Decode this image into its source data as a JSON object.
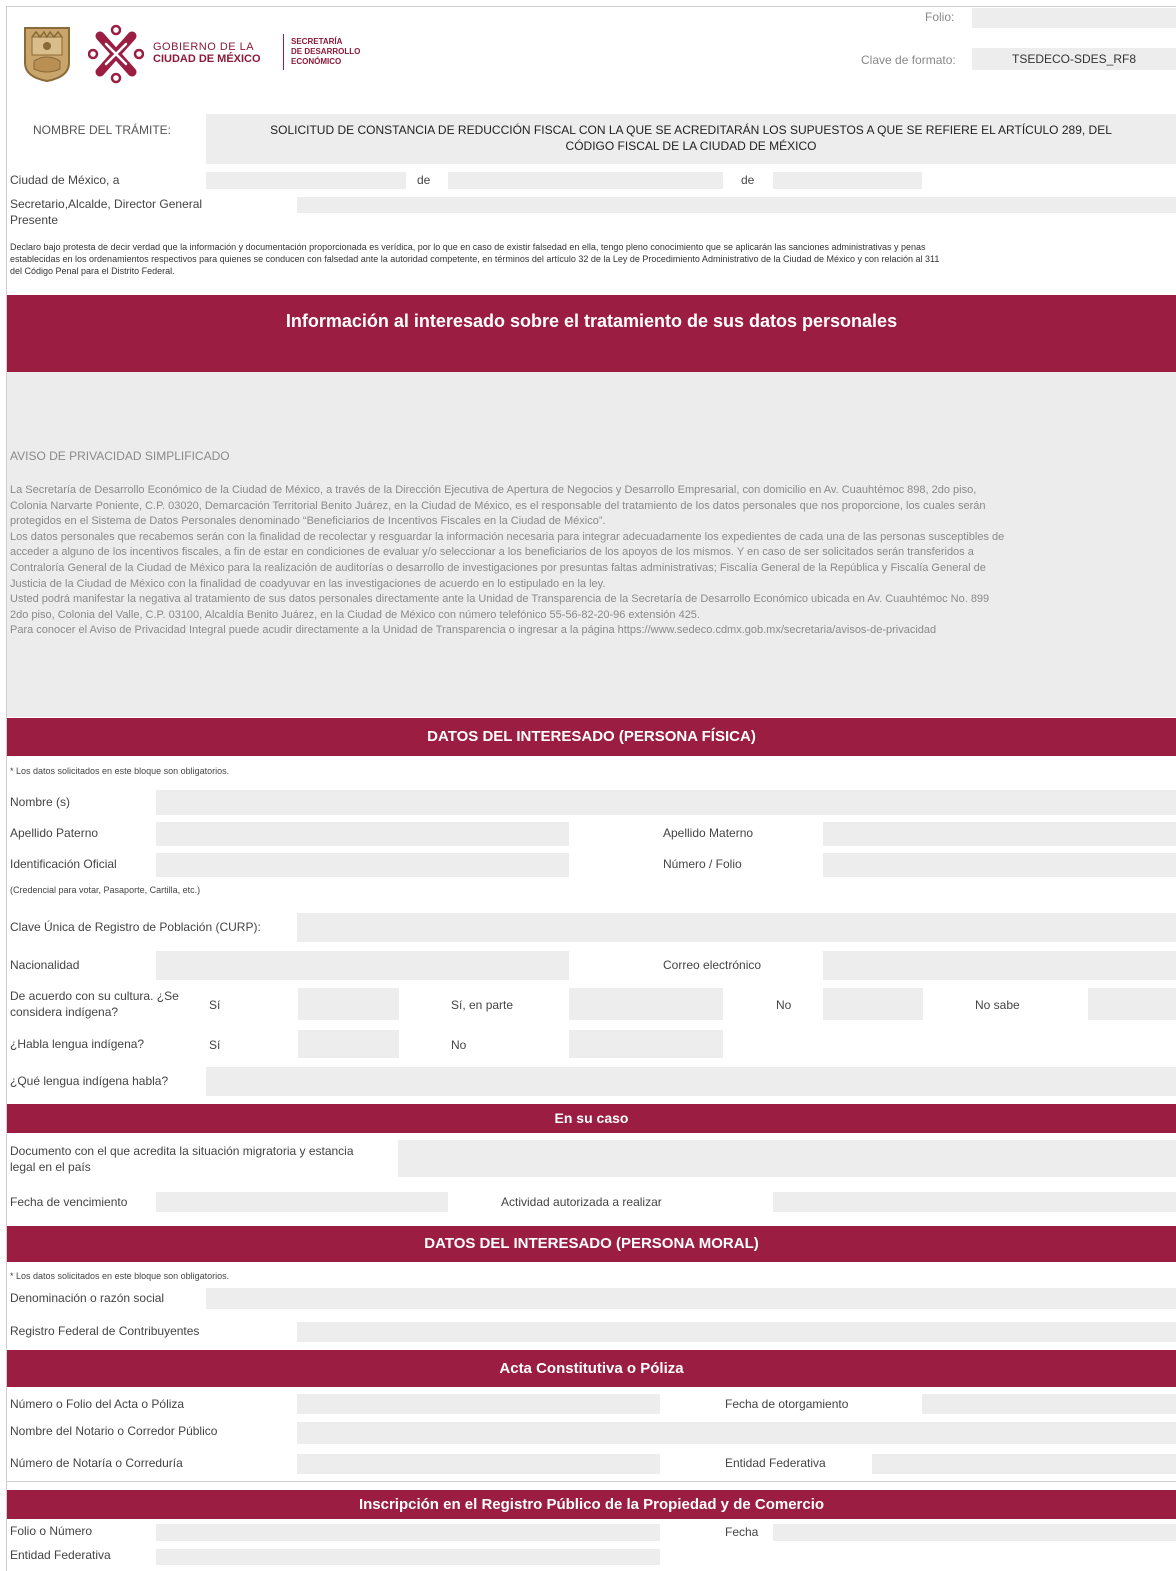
{
  "header": {
    "gov_line1": "GOBIERNO DE LA",
    "gov_line2": "CIUDAD DE MÉXICO",
    "sec_line1": "SECRETARÍA",
    "sec_line2": "DE DESARROLLO",
    "sec_line3": "ECONÓMICO",
    "folio_label": "Folio:",
    "folio_value": "",
    "clave_label": "Clave de formato:",
    "clave_value": "TSEDECO-SDES_RF8"
  },
  "tramite": {
    "label": "NOMBRE DEL TRÁMITE:",
    "value_line1": "SOLICITUD DE CONSTANCIA DE REDUCCIÓN FISCAL CON LA QUE SE ACREDITARÁN LOS SUPUESTOS A QUE SE REFIERE EL ARTÍCULO 289,  DEL",
    "value_line2": "CÓDIGO FISCAL DE LA CIUDAD DE MÉXICO"
  },
  "fecha": {
    "city_label": "Ciudad de México, a",
    "de1": "de",
    "de2": "de"
  },
  "destinatario": {
    "line1": "Secretario,Alcalde, Director General",
    "line2": "Presente"
  },
  "declaracion": {
    "line1": "Declaro bajo protesta de decir verdad que la información y documentación proporcionada es verídica, por lo que en caso de existir falsedad en ella, tengo pleno conocimiento que se aplicarán las sanciones administrativas y penas",
    "line2": "establecidas en los ordenamientos respectivos para quienes se conducen con falsedad ante la autoridad competente, en términos del artículo 32 de la Ley de Procedimiento Administrativo de la Ciudad de México y con relación al 311",
    "line3": "del Código Penal para el Distrito Federal."
  },
  "privacy": {
    "header": "Información al interesado sobre el tratamiento de sus datos personales",
    "title": "AVISO DE PRIVACIDAD SIMPLIFICADO",
    "lines": [
      "La Secretaría de  Desarrollo Económico de la Ciudad de México, a través de la Dirección Ejecutiva de Apertura de Negocios y Desarrollo Empresarial, con domicilio en  Av. Cuauhtémoc 898, 2do piso,",
      "Colonia Narvarte Poniente, C.P. 03020, Demarcación Territorial Benito Juárez, en la Ciudad de México, es el responsable del tratamiento de los datos personales que nos proporcione, los cuales serán",
      "protegidos en el Sistema de Datos Personales denominado “Beneficiarios de Incentivos Fiscales en la Ciudad de México”.",
      "Los datos personales que recabemos serán con la finalidad de recolectar y resguardar la información necesaria para integrar adecuadamente los expedientes de cada una de las personas susceptibles de",
      "acceder a alguno de los incentivos fiscales, a fin de estar en condiciones de evaluar y/o seleccionar a los beneficiarios de los apoyos de los mismos. Y en caso de ser solicitados serán transferidos a",
      "Contraloría General de la Ciudad de México para la realización de auditorías o desarrollo de investigaciones por presuntas faltas administrativas; Fiscalía General de la República y Fiscalía General de",
      "Justicia de la Ciudad de México con la finalidad de coadyuvar en las investigaciones de acuerdo en lo estipulado en la ley.",
      "Usted podrá manifestar la negativa al tratamiento de sus datos personales directamente ante la Unidad de Transparencia de la Secretaría de Desarrollo Económico ubicada en Av. Cuauhtémoc No. 899",
      "2do piso, Colonia del Valle, C.P. 03100, Alcaldía Benito Juárez, en la Ciudad de México con número telefónico 55-56-82-20-96 extensión 425.",
      "Para conocer el Aviso de Privacidad Integral puede acudir directamente a la Unidad de Transparencia o ingresar a la página https://www.sedeco.cdmx.gob.mx/secretaria/avisos-de-privacidad"
    ]
  },
  "fisica": {
    "header": "DATOS DEL INTERESADO  (PERSONA FÍSICA)",
    "note": "* Los datos solicitados en este bloque son obligatorios.",
    "nombre": "Nombre (s)",
    "apellido_paterno": "Apellido Paterno",
    "apellido_materno": "Apellido Materno",
    "identificacion": "Identificación Oficial",
    "numero_folio": "Número / Folio",
    "credencial_note": "(Credencial para votar, Pasaporte, Cartilla, etc.)",
    "curp": "Clave Única de Registro de Población (CURP):",
    "nacionalidad": "Nacionalidad",
    "correo": "Correo electrónico",
    "indigena_q1": "De acuerdo con su cultura. ¿Se",
    "indigena_q2": "considera indígena?",
    "si": "Sí",
    "si_parte": "Sí, en parte",
    "no": "No",
    "no_sabe": "No sabe",
    "habla_q": "¿Habla lengua indígena?",
    "habla_si": "Sí",
    "habla_no": "No",
    "que_lengua": "¿Qué lengua indígena habla?"
  },
  "en_su_caso": {
    "header": "En su caso",
    "documento_line1": "Documento con el que acredita la situación migratoria y estancia",
    "documento_line2": "legal en el país",
    "fecha_vencimiento": "Fecha de vencimiento",
    "actividad": "Actividad autorizada a realizar"
  },
  "moral": {
    "header": "DATOS DEL INTERESADO  (PERSONA MORAL)",
    "note": "* Los datos solicitados en este bloque son obligatorios.",
    "denominacion": "Denominación o razón social",
    "rfc": "Registro Federal de Contribuyentes"
  },
  "acta": {
    "header": "Acta Constitutiva o Póliza",
    "numero_folio": "Número o Folio del Acta o Póliza",
    "fecha_otorgamiento": "Fecha de otorgamiento",
    "notario": "Nombre del Notario o Corredor Público",
    "numero_notaria": "Número de Notaría o Correduría",
    "entidad": "Entidad Federativa"
  },
  "registro": {
    "header": "Inscripción en el Registro Público de la Propiedad y de Comercio",
    "folio": "Folio o Número",
    "fecha": "Fecha",
    "entidad": "Entidad Federativa"
  },
  "colors": {
    "header_bg": "#9b1e42",
    "field_bg": "#ededed",
    "privacy_bg": "#ececec"
  }
}
